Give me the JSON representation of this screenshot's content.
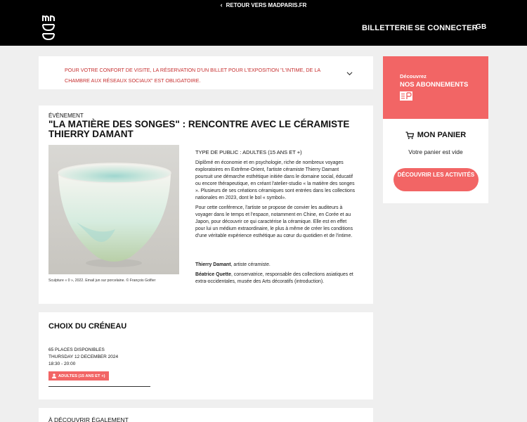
{
  "topbar": {
    "back_label": "RETOUR VERS MADPARIS.FR"
  },
  "header": {
    "logo": "MAD",
    "nav": [
      "BILLETTERIE",
      "SE CONNECTER",
      "GB"
    ]
  },
  "notice": {
    "text": "POUR VOTRE CONFORT DE VISITE, LA RÉSERVATION D'UN BILLET POUR L'EXPOSITION \"L'INTIME, DE LA CHAMBRE AUX RÉSEAUX SOCIAUX\" EST OBLIGATOIRE."
  },
  "event": {
    "kicker": "ÉVÈNEMENT",
    "title": "\"LA MATIÈRE DES SONGES\" : RENCONTRE AVEC LE CÉRAMISTE THIERRY DAMANT",
    "photo_caption": "Sculpture « 0 », 2022. Email jun sur porcelaine. © François Golfier",
    "audience": "TYPE DE PUBLIC : ADULTES (15 ANS ET +)",
    "paragraph1": "Diplômé en économie et en psychologie, riche de nombreux voyages exploratoires en Extrême-Orient, l'artiste céramiste Thierry Damant poursuit une démarche esthétique initiée dans le domaine social, éducatif ou encore thérapeutique, en créant l'atelier-studio « la matière des songes ». Plusieurs de ses créations céramiques sont entrées dans les collections nationales en 2023, dont le bol « symbol».",
    "paragraph2": "Pour cette conférence, l'artiste se propose de convier les auditeurs à voyager dans le temps et l'espace, notamment en Chine, en Corée et au Japon, pour découvrir ce qui caractérise la céramique. Elle est en effet pour lui un médium extraordinaire, le plus à même de créer les conditions d'une véritable expérience esthétique au cœur du quotidien et de l'intime.",
    "speaker1_name": "Thierry Damant",
    "speaker1_role": ", artiste céramiste.",
    "speaker2_name": "Béatrice Quette",
    "speaker2_role": ", conservatrice, responsable des collections asiatiques et extra-occidentales, musée des Arts décoratifs (introduction)."
  },
  "slot": {
    "title": "CHOIX DU CRÉNEAU",
    "places": "65 PLACES DISPONIBLES",
    "date": "THURSDAY 12 DECEMBER 2024",
    "time": "18:30 - 20:00",
    "badge": "ADULTES (15 ANS ET +)"
  },
  "discover": {
    "title": "À DÉCOUVRIR ÉGALEMENT"
  },
  "promo": {
    "kicker": "Découvrez",
    "title": "NOS ABONNEMENTS"
  },
  "cart": {
    "title": "MON PANIER",
    "empty_text": "Votre panier est vide",
    "button": "DÉCOUVRIR LES ACTIVITÉS"
  },
  "colors": {
    "accent": "#f26565",
    "notice_text": "#c62f2f",
    "header_bg": "#000000",
    "page_bg": "#efefef"
  },
  "icons": [
    "chevron-left-icon",
    "chevron-down-icon",
    "cart-icon",
    "user-icon",
    "subscription-card-icon"
  ]
}
